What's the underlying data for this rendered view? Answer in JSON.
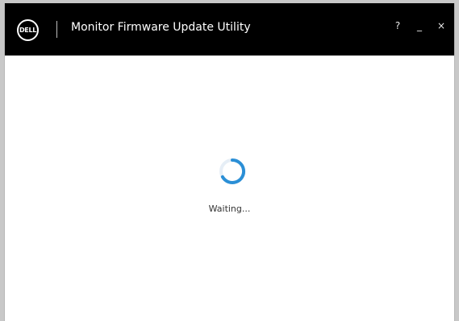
{
  "window": {
    "title": "Monitor Firmware Update Utility",
    "logo_text": "DELL",
    "controls": {
      "help": "?",
      "minimize": "_",
      "close": "×"
    }
  },
  "content": {
    "status_text": "Waiting...",
    "spinner_icon": "loading-spinner-icon"
  },
  "colors": {
    "titlebar": "#000000",
    "accent": "#2b8fd6",
    "background": "#ffffff"
  }
}
